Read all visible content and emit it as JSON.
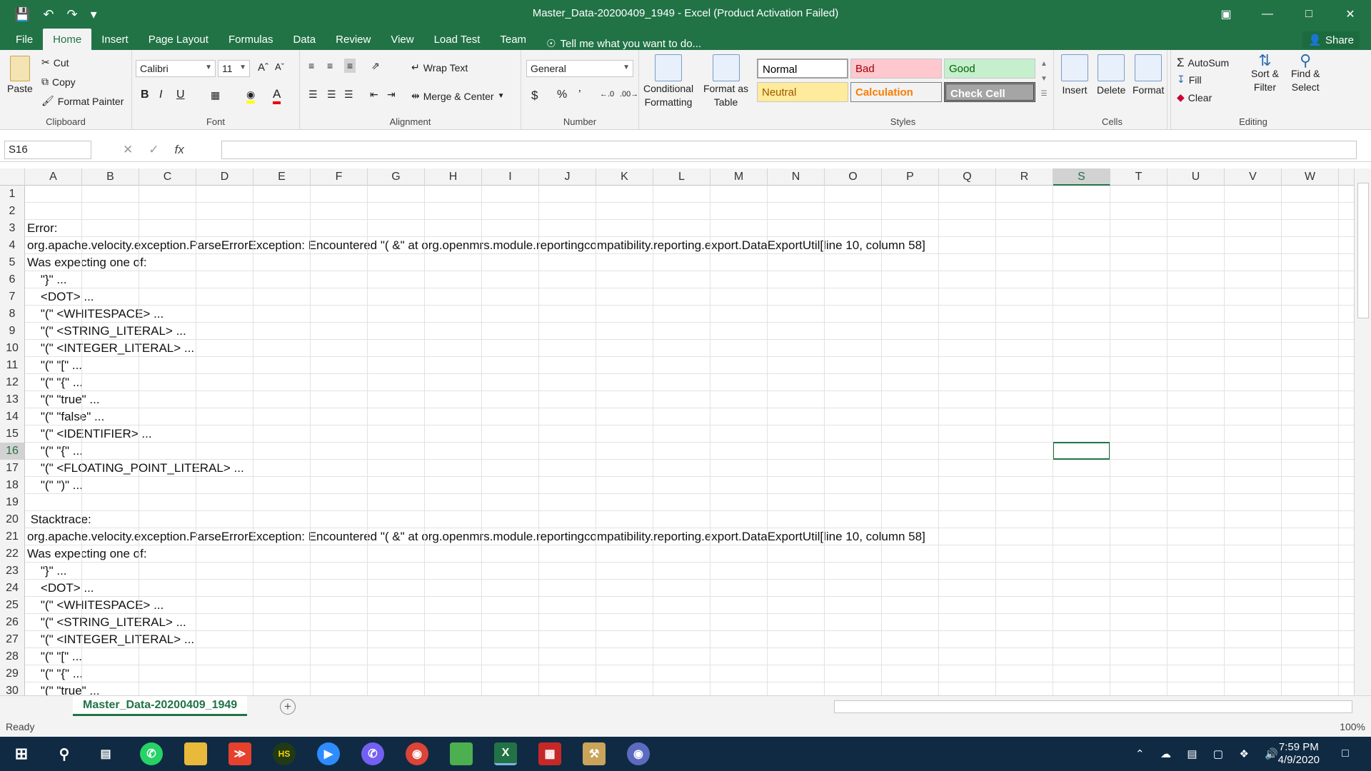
{
  "window": {
    "title": "Master_Data-20200409_1949 - Excel (Product Activation Failed)"
  },
  "tabs": [
    "File",
    "Home",
    "Insert",
    "Page Layout",
    "Formulas",
    "Data",
    "Review",
    "View",
    "Load Test",
    "Team"
  ],
  "tell_me": "Tell me what you want to do...",
  "share": "Share",
  "ribbon": {
    "clipboard": {
      "paste": "Paste",
      "cut": "Cut",
      "copy": "Copy",
      "format_painter": "Format Painter",
      "label": "Clipboard"
    },
    "font": {
      "name": "Calibri",
      "size": "11",
      "label": "Font"
    },
    "alignment": {
      "wrap_text": "Wrap Text",
      "merge_center": "Merge & Center",
      "label": "Alignment"
    },
    "number": {
      "format": "General",
      "label": "Number"
    },
    "styles": {
      "conditional": "Conditional",
      "conditional2": "Formatting",
      "format_as": "Format as",
      "format_as2": "Table",
      "normal": "Normal",
      "bad": "Bad",
      "good": "Good",
      "neutral": "Neutral",
      "calculation": "Calculation",
      "check_cell": "Check Cell",
      "label": "Styles"
    },
    "cells": {
      "insert": "Insert",
      "delete": "Delete",
      "format": "Format",
      "label": "Cells"
    },
    "editing": {
      "autosum": "AutoSum",
      "fill": "Fill",
      "clear": "Clear",
      "sort": "Sort &",
      "sort2": "Filter",
      "find": "Find &",
      "find2": "Select",
      "label": "Editing"
    }
  },
  "name_box": "S16",
  "columns": [
    "A",
    "B",
    "C",
    "D",
    "E",
    "F",
    "G",
    "H",
    "I",
    "J",
    "K",
    "L",
    "M",
    "N",
    "O",
    "P",
    "Q",
    "R",
    "S",
    "T",
    "U",
    "V",
    "W"
  ],
  "selected_column": "S",
  "selected_row": "16",
  "rows": [
    {
      "n": "1",
      "text": ""
    },
    {
      "n": "2",
      "text": ""
    },
    {
      "n": "3",
      "text": "Error:"
    },
    {
      "n": "4",
      "text": "org.apache.velocity.exception.ParseErrorException: Encountered \"( &\" at org.openmrs.module.reportingcompatibility.reporting.export.DataExportUtil[line 10, column 58]"
    },
    {
      "n": "5",
      "text": "Was expecting one of:"
    },
    {
      "n": "6",
      "text": "    \"}\" ..."
    },
    {
      "n": "7",
      "text": "    <DOT> ..."
    },
    {
      "n": "8",
      "text": "    \"(\" <WHITESPACE> ..."
    },
    {
      "n": "9",
      "text": "    \"(\" <STRING_LITERAL> ..."
    },
    {
      "n": "10",
      "text": "    \"(\" <INTEGER_LITERAL> ..."
    },
    {
      "n": "11",
      "text": "    \"(\" \"[\" ..."
    },
    {
      "n": "12",
      "text": "    \"(\" \"{\" ..."
    },
    {
      "n": "13",
      "text": "    \"(\" \"true\" ..."
    },
    {
      "n": "14",
      "text": "    \"(\" \"false\" ..."
    },
    {
      "n": "15",
      "text": "    \"(\" <IDENTIFIER> ..."
    },
    {
      "n": "16",
      "text": "    \"(\" \"{\" ..."
    },
    {
      "n": "17",
      "text": "    \"(\" <FLOATING_POINT_LITERAL> ..."
    },
    {
      "n": "18",
      "text": "    \"(\" \")\" ..."
    },
    {
      "n": "19",
      "text": ""
    },
    {
      "n": "20",
      "text": " Stacktrace:"
    },
    {
      "n": "21",
      "text": "org.apache.velocity.exception.ParseErrorException: Encountered \"( &\" at org.openmrs.module.reportingcompatibility.reporting.export.DataExportUtil[line 10, column 58]"
    },
    {
      "n": "22",
      "text": "Was expecting one of:"
    },
    {
      "n": "23",
      "text": "    \"}\" ..."
    },
    {
      "n": "24",
      "text": "    <DOT> ..."
    },
    {
      "n": "25",
      "text": "    \"(\" <WHITESPACE> ..."
    },
    {
      "n": "26",
      "text": "    \"(\" <STRING_LITERAL> ..."
    },
    {
      "n": "27",
      "text": "    \"(\" <INTEGER_LITERAL> ..."
    },
    {
      "n": "28",
      "text": "    \"(\" \"[\" ..."
    },
    {
      "n": "29",
      "text": "    \"(\" \"{\" ..."
    },
    {
      "n": "30",
      "text": "    \"(\" \"true\" ..."
    }
  ],
  "sheet_tab": "Master_Data-20200409_1949",
  "status": {
    "ready": "Ready",
    "zoom": "100%"
  },
  "clock": {
    "time": "7:59 PM",
    "date": "4/9/2020"
  },
  "colors": {
    "excel_green": "#217346",
    "taskbar": "#102a43"
  }
}
